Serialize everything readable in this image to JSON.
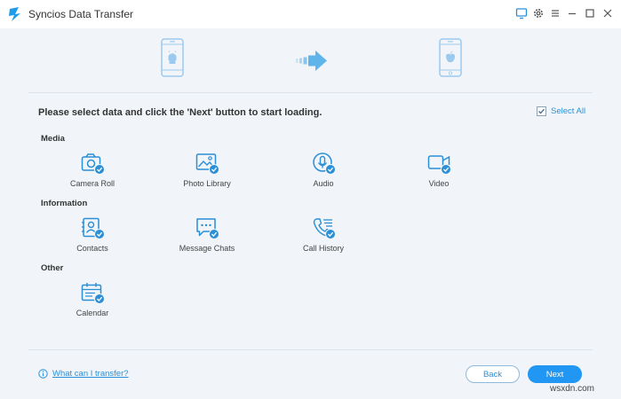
{
  "window": {
    "title": "Syncios Data Transfer"
  },
  "instruction": "Please select data and click the 'Next' button to start loading.",
  "select_all": {
    "label": "Select All",
    "checked": true
  },
  "sections": {
    "media": {
      "label": "Media"
    },
    "information": {
      "label": "Information"
    },
    "other": {
      "label": "Other"
    }
  },
  "items": {
    "camera_roll": "Camera Roll",
    "photo_library": "Photo Library",
    "audio": "Audio",
    "video": "Video",
    "contacts": "Contacts",
    "message_chats": "Message Chats",
    "call_history": "Call History",
    "calendar": "Calendar"
  },
  "footer": {
    "help_link": "What can I transfer?",
    "back_label": "Back",
    "next_label": "Next"
  },
  "watermark": "wsxdn.com",
  "colors": {
    "accent": "#2196f3",
    "icon": "#2a8fd6",
    "background": "#f1f5f9",
    "arrow": "#5fb4ea"
  }
}
